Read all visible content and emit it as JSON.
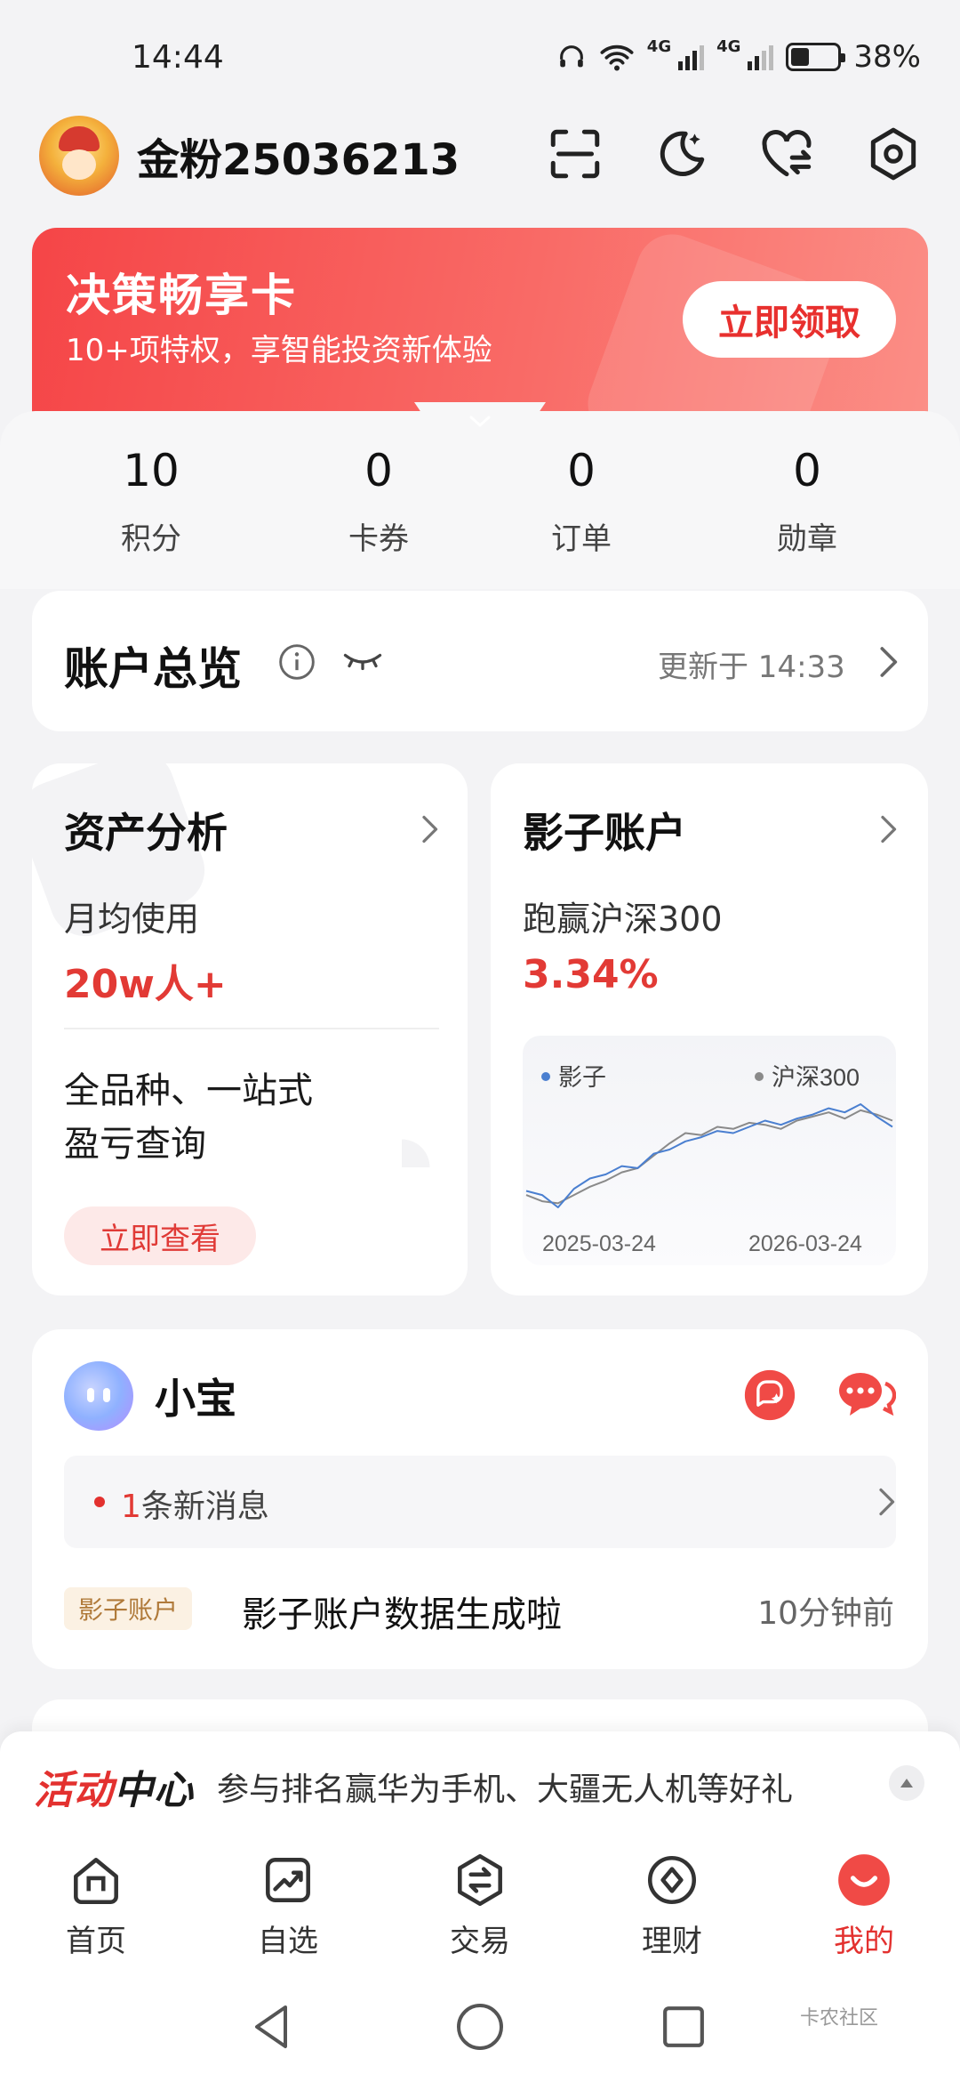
{
  "status_bar": {
    "time": "14:44",
    "network_1": "4G",
    "network_2": "4G",
    "battery": "38%",
    "icons": [
      "headphones-icon",
      "wifi-icon",
      "signal-icon",
      "battery-icon"
    ]
  },
  "header": {
    "username": "金粉25036213",
    "icons": [
      "scan-icon",
      "dark-mode-icon",
      "heart-switch-icon",
      "settings-icon"
    ]
  },
  "banner": {
    "title": "决策畅享卡",
    "subtitle": "10+项特权，享智能投资新体验",
    "button": "立即领取"
  },
  "stats": [
    {
      "value": "10",
      "label": "积分"
    },
    {
      "value": "0",
      "label": "卡券"
    },
    {
      "value": "0",
      "label": "订单"
    },
    {
      "value": "0",
      "label": "勋章"
    }
  ],
  "overview": {
    "title": "账户总览",
    "updated": "更新于 14:33"
  },
  "asset_card": {
    "title": "资产分析",
    "subtitle": "月均使用",
    "metric": "20w人+",
    "desc_line1": "全品种、一站式",
    "desc_line2": "盈亏查询",
    "button": "立即查看"
  },
  "shadow_card": {
    "title": "影子账户",
    "subtitle": "跑赢沪深300",
    "metric": "3.34%",
    "chart_data": {
      "type": "line",
      "x_start": "2025-03-24",
      "x_end": "2026-03-24",
      "series": [
        {
          "name": "影子",
          "color": "#4a7fd0",
          "values": [
            0.2,
            0.0,
            -0.6,
            0.3,
            0.8,
            1.0,
            1.4,
            1.3,
            2.0,
            2.2,
            2.6,
            2.8,
            3.1,
            3.0,
            3.3,
            3.6,
            3.4,
            3.7,
            3.9,
            4.2,
            4.0,
            4.4,
            3.8,
            3.3
          ]
        },
        {
          "name": "沪深300",
          "color": "#8a8a8a",
          "values": [
            0.0,
            -0.3,
            -0.4,
            0.0,
            0.4,
            0.7,
            1.1,
            1.3,
            1.9,
            2.5,
            3.0,
            2.9,
            3.3,
            3.2,
            3.5,
            3.4,
            3.2,
            3.6,
            3.8,
            4.0,
            3.7,
            4.1,
            3.9,
            3.6
          ]
        }
      ],
      "x_labels": [
        "2025-03-24",
        "2026-03-24"
      ]
    }
  },
  "xiaobao": {
    "title": "小宝",
    "msg_count": "1",
    "msg_suffix": "条新消息",
    "tag": "影子账户",
    "feed_text": "影子账户数据生成啦",
    "feed_time": "10分钟前"
  },
  "activity": {
    "logo_a": "活动",
    "logo_b": "中心",
    "text": "参与排名赢华为手机、大疆无人机等好礼"
  },
  "nav": [
    {
      "label": "首页",
      "icon": "home-icon"
    },
    {
      "label": "自选",
      "icon": "watchlist-icon"
    },
    {
      "label": "交易",
      "icon": "trade-icon"
    },
    {
      "label": "理财",
      "icon": "wealth-icon"
    },
    {
      "label": "我的",
      "icon": "profile-icon"
    }
  ],
  "watermark": "卡农社区",
  "colors": {
    "accent": "#e3312f",
    "banner": "#f54547"
  }
}
